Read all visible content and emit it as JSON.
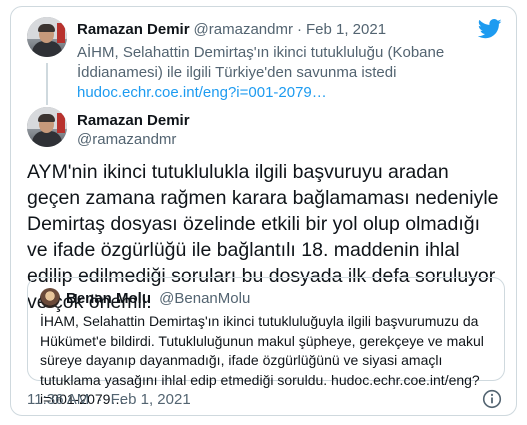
{
  "parent_tweet": {
    "name": "Ramazan Demir",
    "handle": "@ramazandmr",
    "separator": "·",
    "date": "Feb 1, 2021",
    "text": "AİHM, Selahattin Demirtaş'ın ikinci tutukluluğu (Kobane İddianamesi) ile ilgili Türkiye'den savunma istedi ",
    "link": "hudoc.echr.coe.int/eng?i=001-2079…"
  },
  "main_tweet": {
    "name": "Ramazan Demir",
    "handle": "@ramazandmr",
    "text": "AYM'nin ikinci tutuklulukla ilgili başvuruyu aradan geçen zamana rağmen karara bağlamaması nedeniyle Demirtaş dosyası özelinde etkili bir yol olup olmadığı ve ifade özgürlüğü ile bağlantılı 18. maddenin ihlal edilip edilmediği soruları bu dosyada ilk defa soruluyor ve çok önemli."
  },
  "quoted_tweet": {
    "name": "Benan Molu",
    "handle": "@BenanMolu",
    "text": "İHAM, Selahattin Demirtaş'ın ikinci tutukluluğuyla ilgili başvurumuzu da Hükümet'e bildirdi. Tutukluluğunun makul şüpheye, gerekçeye ve makul süreye dayanıp dayanmadığı, ifade özgürlüğünü ve siyasi amaçlı tutuklama yasağını ihlal edip etmediği soruldu. hudoc.echr.coe.int/eng?i=001-2079…"
  },
  "footer": {
    "time": "11:36 AM",
    "separator": "·",
    "date": "Feb 1, 2021"
  },
  "colors": {
    "accent": "#1d9bf0",
    "secondary_text": "#536471",
    "border": "#cfd9de"
  },
  "icons": {
    "brand": "twitter-bird-icon",
    "info": "info-icon"
  }
}
